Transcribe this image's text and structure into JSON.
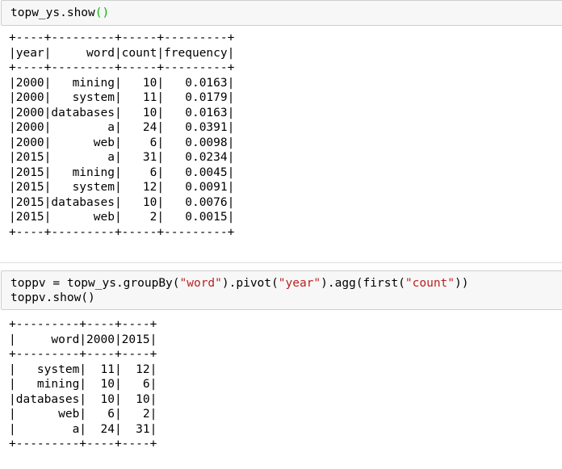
{
  "cell1": {
    "code": "topw_ys.show",
    "code_paren": "()",
    "output_lines": [
      "+----+---------+-----+---------+",
      "|year|     word|count|frequency|",
      "+----+---------+-----+---------+",
      "|2000|   mining|   10|   0.0163|",
      "|2000|   system|   11|   0.0179|",
      "|2000|databases|   10|   0.0163|",
      "|2000|        a|   24|   0.0391|",
      "|2000|      web|    6|   0.0098|",
      "|2015|        a|   31|   0.0234|",
      "|2015|   mining|    6|   0.0045|",
      "|2015|   system|   12|   0.0091|",
      "|2015|databases|   10|   0.0076|",
      "|2015|      web|    2|   0.0015|",
      "+----+---------+-----+---------+"
    ]
  },
  "cell2": {
    "line1": {
      "p1": "toppv = topw_ys.groupBy(",
      "s1": "\"word\"",
      "p2": ").pivot(",
      "s2": "\"year\"",
      "p3": ").agg(first(",
      "s3": "\"count\"",
      "p4": "))"
    },
    "line2": "toppv.show()",
    "output_lines": [
      "+---------+----+----+",
      "|     word|2000|2015|",
      "+---------+----+----+",
      "|   system|  11|  12|",
      "|   mining|  10|   6|",
      "|databases|  10|  10|",
      "|      web|   6|   2|",
      "|        a|  24|  31|",
      "+---------+----+----+"
    ]
  }
}
